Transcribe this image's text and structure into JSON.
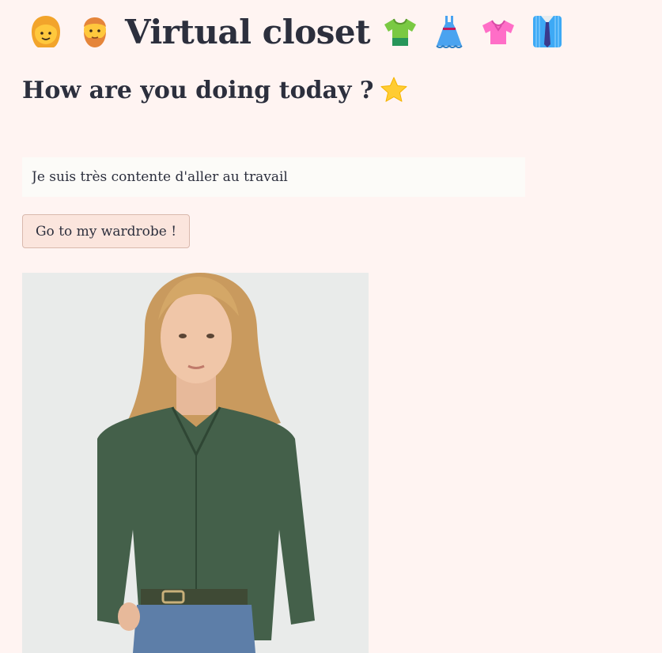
{
  "header": {
    "title": "Virtual closet",
    "icons_left": [
      "woman-emoji-icon",
      "bearded-man-emoji-icon"
    ],
    "icons_right": [
      "t-shirt-emoji-icon",
      "dress-emoji-icon",
      "blouse-emoji-icon",
      "suit-shirt-tie-emoji-icon"
    ]
  },
  "subtitle": {
    "text": "How are you doing today ?",
    "icon": "star-emoji-icon"
  },
  "mood_input": {
    "value": "Je suis très contente d'aller au travail"
  },
  "wardrobe_button": {
    "label": "Go to my wardrobe !"
  },
  "outfit_photo": {
    "subject": "woman in dark green blouse and jeans"
  },
  "colors": {
    "background": "#fff4f2",
    "text": "#2c2f3d",
    "input_bg": "#fcfbf8",
    "button_bg": "#fbe5dd",
    "button_border": "#d9b9ad"
  }
}
